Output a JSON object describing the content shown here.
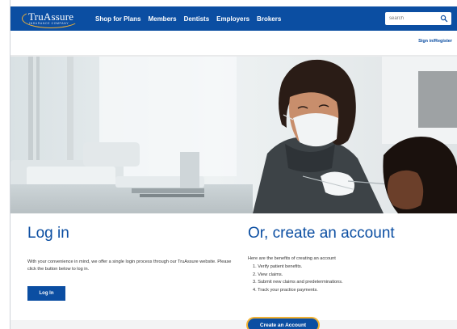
{
  "header": {
    "logo_text": "TruAssure",
    "logo_subtext": "INSURANCE COMPANY",
    "nav": [
      {
        "label": "Shop for Plans"
      },
      {
        "label": "Members"
      },
      {
        "label": "Dentists"
      },
      {
        "label": "Employers"
      },
      {
        "label": "Brokers"
      }
    ],
    "search_placeholder": "search",
    "sign_in_label": "Sign in/Register"
  },
  "colors": {
    "brand_blue": "#0b4ea2",
    "accent_gold": "#f2b233"
  },
  "icons": {
    "search": "search-icon"
  },
  "login": {
    "title": "Log in",
    "body": "With your convenience in mind, we offer a single login process through our TruAssure website. Please click the button below to log in.",
    "button_label": "Log In"
  },
  "create_account": {
    "title": "Or, create an account",
    "intro": "Here are the benefits of creating an account",
    "benefits": [
      "1. Verify patient benefits.",
      "2. View claims.",
      "3. Submit new claims and predeterminations.",
      "4. Track your practice payments."
    ],
    "button_label": "Create an Account"
  }
}
